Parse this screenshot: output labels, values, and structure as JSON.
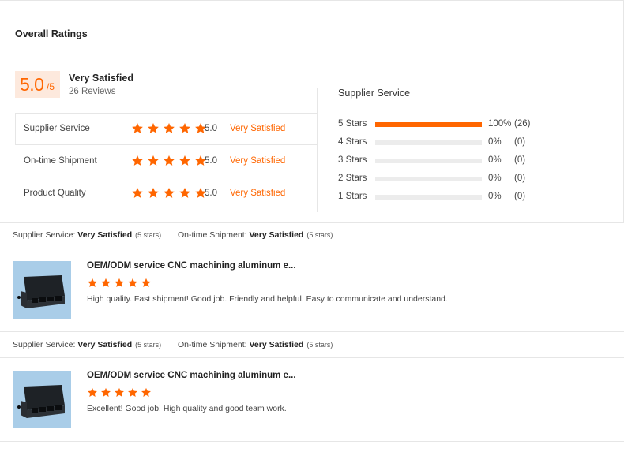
{
  "overall": {
    "title": "Overall Ratings",
    "score": "5.0",
    "score_max": "/5",
    "satisfaction": "Very Satisfied",
    "reviews": "26 Reviews",
    "ratings": [
      {
        "name": "Supplier Service",
        "score": "5.0",
        "label": "Very Satisfied",
        "stars": 5
      },
      {
        "name": "On-time Shipment",
        "score": "5.0",
        "label": "Very Satisfied",
        "stars": 5
      },
      {
        "name": "Product Quality",
        "score": "5.0",
        "label": "Very Satisfied",
        "stars": 5
      }
    ]
  },
  "distribution": {
    "title": "Supplier Service",
    "rows": [
      {
        "label": "5 Stars",
        "percent": "100%",
        "count": "(26)",
        "fraction": 1.0
      },
      {
        "label": "4 Stars",
        "percent": "0%",
        "count": "(0)",
        "fraction": 0
      },
      {
        "label": "3 Stars",
        "percent": "0%",
        "count": "(0)",
        "fraction": 0
      },
      {
        "label": "2 Stars",
        "percent": "0%",
        "count": "(0)",
        "fraction": 0
      },
      {
        "label": "1 Stars",
        "percent": "0%",
        "count": "(0)",
        "fraction": 0
      }
    ]
  },
  "reviews": [
    {
      "supplier_service_label": "Supplier Service:",
      "supplier_service_value": "Very Satisfied",
      "supplier_service_stars": "(5 stars)",
      "shipment_label": "On-time Shipment:",
      "shipment_value": "Very Satisfied",
      "shipment_stars": "(5 stars)",
      "product": "OEM/ODM service CNC machining aluminum e...",
      "stars": 5,
      "text": "High quality. Fast shipment! Good job. Friendly and helpful. Easy to communicate and understand."
    },
    {
      "supplier_service_label": "Supplier Service:",
      "supplier_service_value": "Very Satisfied",
      "supplier_service_stars": "(5 stars)",
      "shipment_label": "On-time Shipment:",
      "shipment_value": "Very Satisfied",
      "shipment_stars": "(5 stars)",
      "product": "OEM/ODM service CNC machining aluminum e...",
      "stars": 5,
      "text": "Excellent! Good job! High quality and good team work."
    }
  ],
  "colors": {
    "accent": "#ff6600",
    "score_bg": "#fde9dd",
    "track": "#ececec"
  }
}
